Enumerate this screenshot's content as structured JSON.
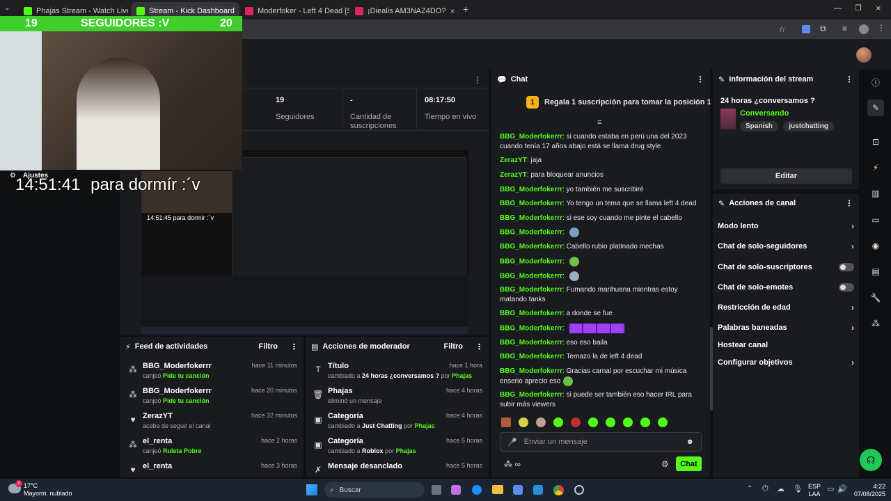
{
  "tabs": [
    {
      "title": "Phajas Stream - Watch Live on K",
      "fav": "#53fc18"
    },
    {
      "title": "Stream - Kick Dashboard",
      "fav": "#53fc18"
    },
    {
      "title": "Moderfoker - Left 4 Dead [SWA",
      "fav": "#e0245e"
    },
    {
      "title": "¡Diealis AM3NAZ4DO?",
      "fav": "#e0245e"
    }
  ],
  "overlay": {
    "follow_left": "19",
    "follow_label": "SEGUIDORES :V",
    "follow_right": "20",
    "settings_label": "Ajustes",
    "clock": "14:51:41",
    "caption": "para dormír :´v",
    "mini_clock": "14:51:45",
    "mini_caption": "para dormir :´v"
  },
  "stats": [
    {
      "value": "19",
      "label": "Seguidores"
    },
    {
      "value": "-",
      "label": "Cantidad de suscripciones"
    },
    {
      "value": "08:17:50",
      "label": "Tiempo en vivo"
    }
  ],
  "chat": {
    "title": "Chat",
    "pinned_rank": "1",
    "pinned_text": "Regala 1 suscripción para tomar la posición 1",
    "messages": [
      {
        "user": "BBG_Moderfokerrr",
        "text": "si cuando estaba en perú una del 2023 cuando tenía 17 años abajo está se llama drug style"
      },
      {
        "user": "ZerazYT",
        "text": "jaja"
      },
      {
        "user": "ZerazYT",
        "text": "para bloquear anuncios"
      },
      {
        "user": "BBG_Moderfokerrr",
        "text": "yo también me suscribiré"
      },
      {
        "user": "BBG_Moderfokerrr",
        "text": "Yo tengo un tema que se llama left 4 dead"
      },
      {
        "user": "BBG_Moderfokerrr",
        "text": "si ese soy cuando me pinte el cabello"
      },
      {
        "user": "BBG_Moderfokerrr",
        "text": ""
      },
      {
        "user": "BBG_Moderfokerrr",
        "text": "Cabello rubio platinado mechas"
      },
      {
        "user": "BBG_Moderfokerrr",
        "text": ""
      },
      {
        "user": "BBG_Moderfokerrr",
        "text": ""
      },
      {
        "user": "BBG_Moderfokerrr",
        "text": "Fumando marihuana mientras estoy matando tanks"
      },
      {
        "user": "BBG_Moderfokerrr",
        "text": "a donde se fue"
      },
      {
        "user": "BBG_Moderfokerrr",
        "text": ""
      },
      {
        "user": "BBG_Moderfokerrr",
        "text": "eso eso baila"
      },
      {
        "user": "BBG_Moderfokerrr",
        "text": "Temazo la de left 4 dead"
      },
      {
        "user": "BBG_Moderfokerrr",
        "text": "Gracias carnal por escuchar mi música enserio aprecio eso"
      },
      {
        "user": "BBG_Moderfokerrr",
        "text": "si puede ser también eso hacer IRL para subir más viewers"
      }
    ],
    "input_placeholder": "Enviar un mensaje",
    "send_label": "Chat"
  },
  "stream_info": {
    "title": "Información del stream",
    "stream_title": "24 horas ¿conversamos ?",
    "category": "Conversando",
    "tags": [
      "Spanish",
      "justchatting"
    ],
    "edit_label": "Editar"
  },
  "channel_actions": {
    "title": "Acciones de canal",
    "items": [
      {
        "label": "Modo lento",
        "kind": "chevron"
      },
      {
        "label": "Chat de solo-seguidores",
        "kind": "chevron"
      },
      {
        "label": "Chat de solo-suscriptores",
        "kind": "toggle"
      },
      {
        "label": "Chat de solo-emotes",
        "kind": "toggle"
      },
      {
        "label": "Restricción de edad",
        "kind": "chevron"
      },
      {
        "label": "Palabras baneadas",
        "kind": "chevron"
      },
      {
        "label": "Hostear canal",
        "kind": "none"
      },
      {
        "label": "Configurar objetivos",
        "kind": "chevron"
      }
    ]
  },
  "activity_feed": {
    "title": "Feed de actividades",
    "filter": "Filtro",
    "rows": [
      {
        "name": "BBG_Moderfokerrr",
        "desc_pre": "canjeó",
        "desc_hl": "Pide tu canción",
        "time": "hace 11 minutos"
      },
      {
        "name": "BBG_Moderfokerrr",
        "desc_pre": "canjeó",
        "desc_hl": "Pide tu canción",
        "time": "hace 20 minutos"
      },
      {
        "name": "ZerazYT",
        "desc_pre": "acaba de seguir el canal",
        "desc_hl": "",
        "time": "hace 32 minutos"
      },
      {
        "name": "el_renta",
        "desc_pre": "canjeó",
        "desc_hl": "Ruleta Pobre",
        "time": "hace 2 horas"
      },
      {
        "name": "el_renta",
        "desc_pre": "",
        "desc_hl": "",
        "time": "hace 3 horas"
      }
    ]
  },
  "mod_actions": {
    "title": "Acciones de moderador",
    "filter": "Filtro",
    "rows": [
      {
        "name": "Título",
        "desc_pre": "cambiado a",
        "desc_b": "24 horas ¿conversamos ?",
        "desc_mid": "por",
        "desc_hl": "Phajas",
        "time": "hace 1 hora"
      },
      {
        "name": "Phajas",
        "desc_pre": "eliminó un mensaje",
        "desc_b": "",
        "desc_mid": "",
        "desc_hl": "",
        "time": "hace 4 horas"
      },
      {
        "name": "Categoría",
        "desc_pre": "cambiado a",
        "desc_b": "Just Chatting",
        "desc_mid": "por",
        "desc_hl": "Phajas",
        "time": "hace 4 horas"
      },
      {
        "name": "Categoría",
        "desc_pre": "cambiado a",
        "desc_b": "Roblox",
        "desc_mid": "por",
        "desc_hl": "Phajas",
        "time": "hace 5 horas"
      },
      {
        "name": "Mensaje desanclado",
        "desc_pre": "",
        "desc_b": "",
        "desc_mid": "",
        "desc_hl": "",
        "time": "hace 5 horas"
      }
    ]
  },
  "taskbar": {
    "weather_temp": "17°C",
    "weather_desc": "Mayorm. nublado",
    "search_placeholder": "Buscar",
    "lang1": "ESP",
    "lang2": "LAA",
    "time": "4:22",
    "date": "07/08/2025",
    "badge": "2"
  },
  "colors": {
    "accent": "#53fc18",
    "bg": "#0f1011",
    "panel": "#191b1f"
  }
}
